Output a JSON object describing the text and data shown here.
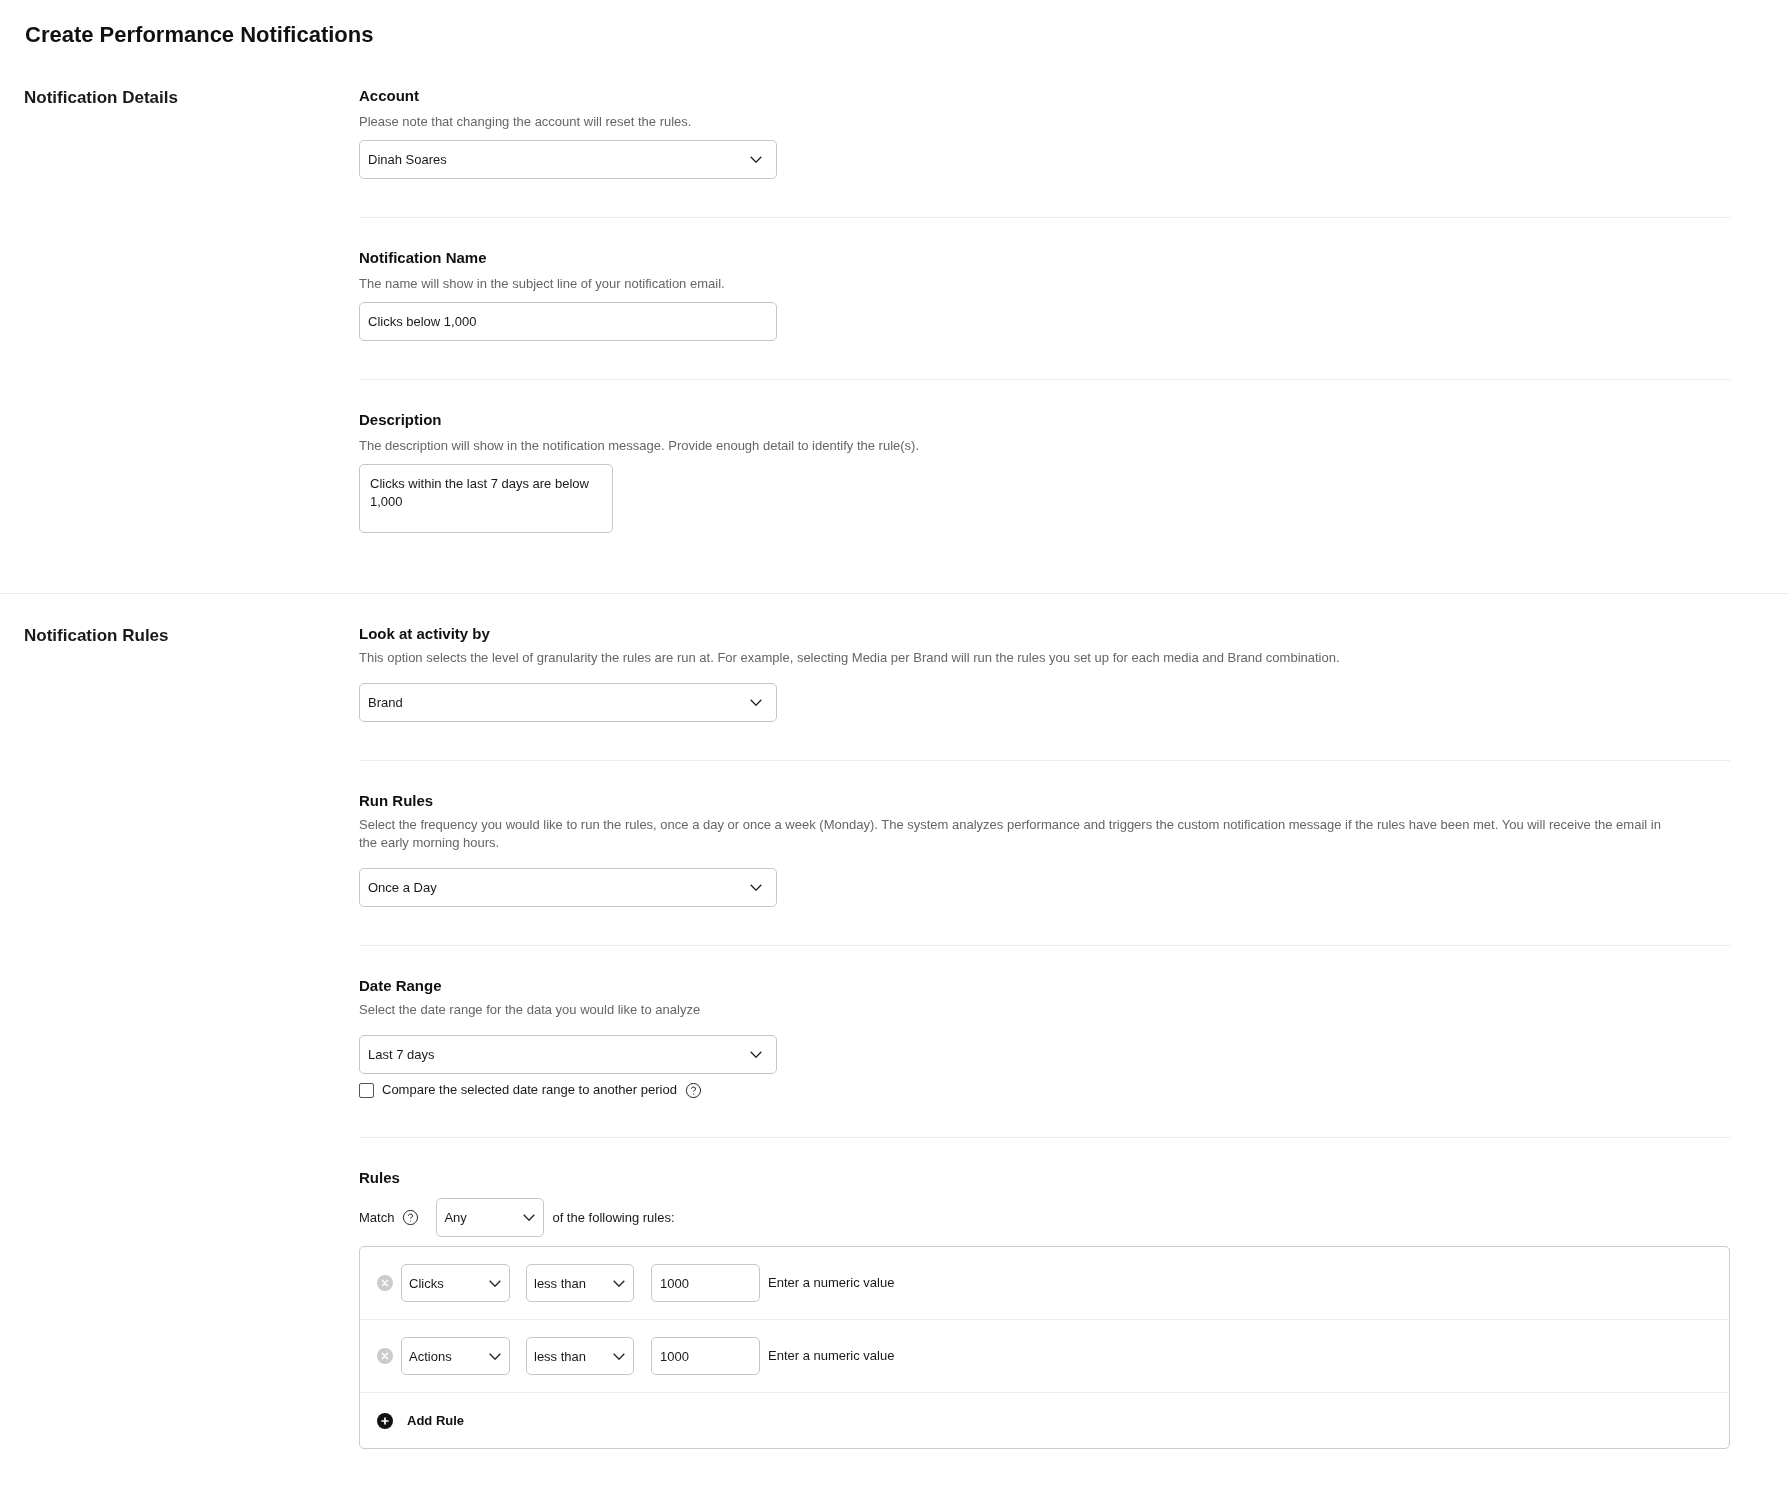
{
  "title": "Create Performance Notifications",
  "sections": [
    {
      "heading": "Notification Details",
      "fields": [
        {
          "kind": "select",
          "label": "Account",
          "help": "Please note that changing the account will reset the rules.",
          "value": "Dinah Soares"
        },
        {
          "kind": "text",
          "label": "Notification Name",
          "help": "The name will show in the subject line of your notification email.",
          "value": "Clicks below 1,000"
        },
        {
          "kind": "textarea",
          "label": "Description",
          "help": "The description will show in the notification message. Provide enough detail to identify the rule(s).",
          "value": "Clicks within the last 7 days are below 1,000"
        }
      ]
    },
    {
      "heading": "Notification Rules",
      "fields": [
        {
          "kind": "select",
          "label": "Look at activity by",
          "help": "This option selects the level of granularity the rules are run at. For example, selecting Media per Brand will run the rules you set up for each media and Brand combination.",
          "value": "Brand"
        },
        {
          "kind": "select",
          "label": "Run Rules",
          "help": "Select the frequency you would like to run the rules, once a day or once a week (Monday). The system analyzes performance and triggers the custom notification message if the rules have been met. You will receive the email in the early morning hours.",
          "value": "Once a Day"
        },
        {
          "kind": "select",
          "label": "Date Range",
          "help": "Select the date range for the data you would like to analyze",
          "value": "Last 7 days",
          "checkbox": {
            "label": "Compare the selected date range to another period",
            "checked": false
          }
        },
        {
          "kind": "rules",
          "label": "Rules",
          "match": {
            "label": "Match",
            "value": "Any",
            "suffix": "of the following rules:"
          },
          "rules": [
            {
              "metric": "Clicks",
              "operator": "less than",
              "value": "1000",
              "hint": "Enter a numeric value"
            },
            {
              "metric": "Actions",
              "operator": "less than",
              "value": "1000",
              "hint": "Enter a numeric value"
            }
          ],
          "add_button": "Add Rule"
        }
      ]
    }
  ]
}
